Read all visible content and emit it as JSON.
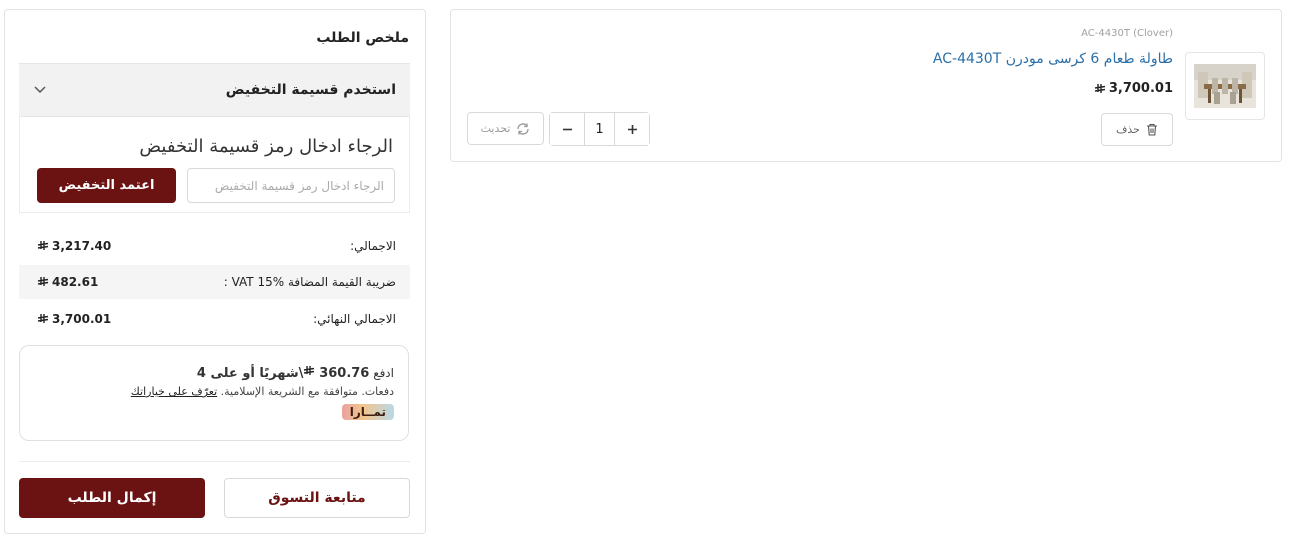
{
  "cart_item": {
    "sku": "AC-4430T (Clover)",
    "title": "طاولة طعام 6 كرسى مودرن AC-4430T",
    "price": "3,700.01",
    "quantity": "1",
    "delete_label": "حذف",
    "refresh_label": "تحديث",
    "image_icon": "dining-table-photo"
  },
  "summary": {
    "title": "ملخص الطلب",
    "coupon": {
      "toggle_label": "استخدم قسيمة التخفيض",
      "heading": "الرجاء ادخال رمز قسيمة التخفيض",
      "input_placeholder": "الرجاء ادخال رمز قسيمة التخفيض",
      "input_value": "",
      "apply_label": "اعتمد التخفيض"
    },
    "totals": {
      "subtotal_label": "الاجمالي:",
      "subtotal_value": "3,217.40",
      "vat_label": "ضريبة القيمة المضافة %15 VAT :",
      "vat_value": "482.61",
      "final_label": "الاجمالي النهائي:",
      "final_value": "3,700.01"
    },
    "tamara": {
      "line1_prefix": "ادفع",
      "line1_amount": "360.76",
      "line1_suffix": "\\شهريًا أو على 4",
      "line2_text": "دفعات. متوافقة مع الشريعة الإسلامية.",
      "line2_link": "تعرّف على خياراتك",
      "badge": "تمــارا"
    },
    "continue_label": "متابعة التسوق",
    "checkout_label": "إكمال الطلب"
  },
  "colors": {
    "brand": "#6b1313",
    "link": "#2b6fa8",
    "panel_bg": "#f2f2f2"
  }
}
